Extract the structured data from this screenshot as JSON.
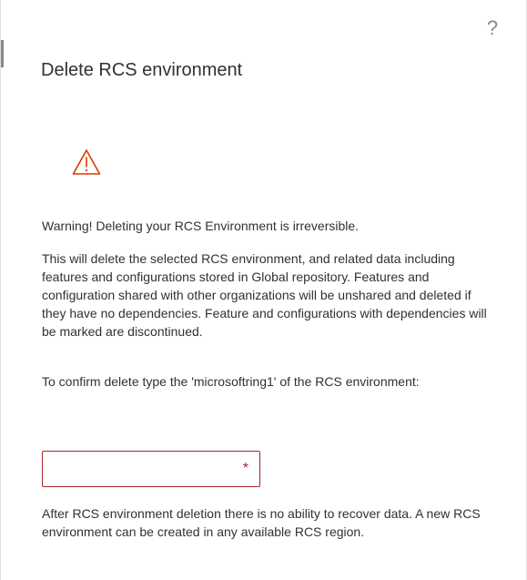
{
  "dialog": {
    "title": "Delete RCS environment",
    "help_label": "?",
    "warning_icon": "warning-triangle-icon",
    "warning_text": "Warning! Deleting your RCS Environment is irreversible.",
    "description": "This will delete the selected RCS environment, and related data including features and configurations stored in Global repository. Features and configuration shared with other organizations will be unshared and deleted if they have no dependencies. Feature and configurations with dependencies will be marked are discontinued.",
    "confirm_prompt": "To confirm delete type the 'microsoftring1' of the RCS environment:",
    "confirm_field": {
      "value": "",
      "placeholder": "",
      "required_marker": "*"
    },
    "after_note": "After RCS environment deletion there is no ability to recover data. A new RCS environment can be created in any available RCS region."
  },
  "colors": {
    "warning": "#d83b01",
    "error_border": "#a4262c",
    "text": "#323130",
    "muted": "#8a8886"
  }
}
